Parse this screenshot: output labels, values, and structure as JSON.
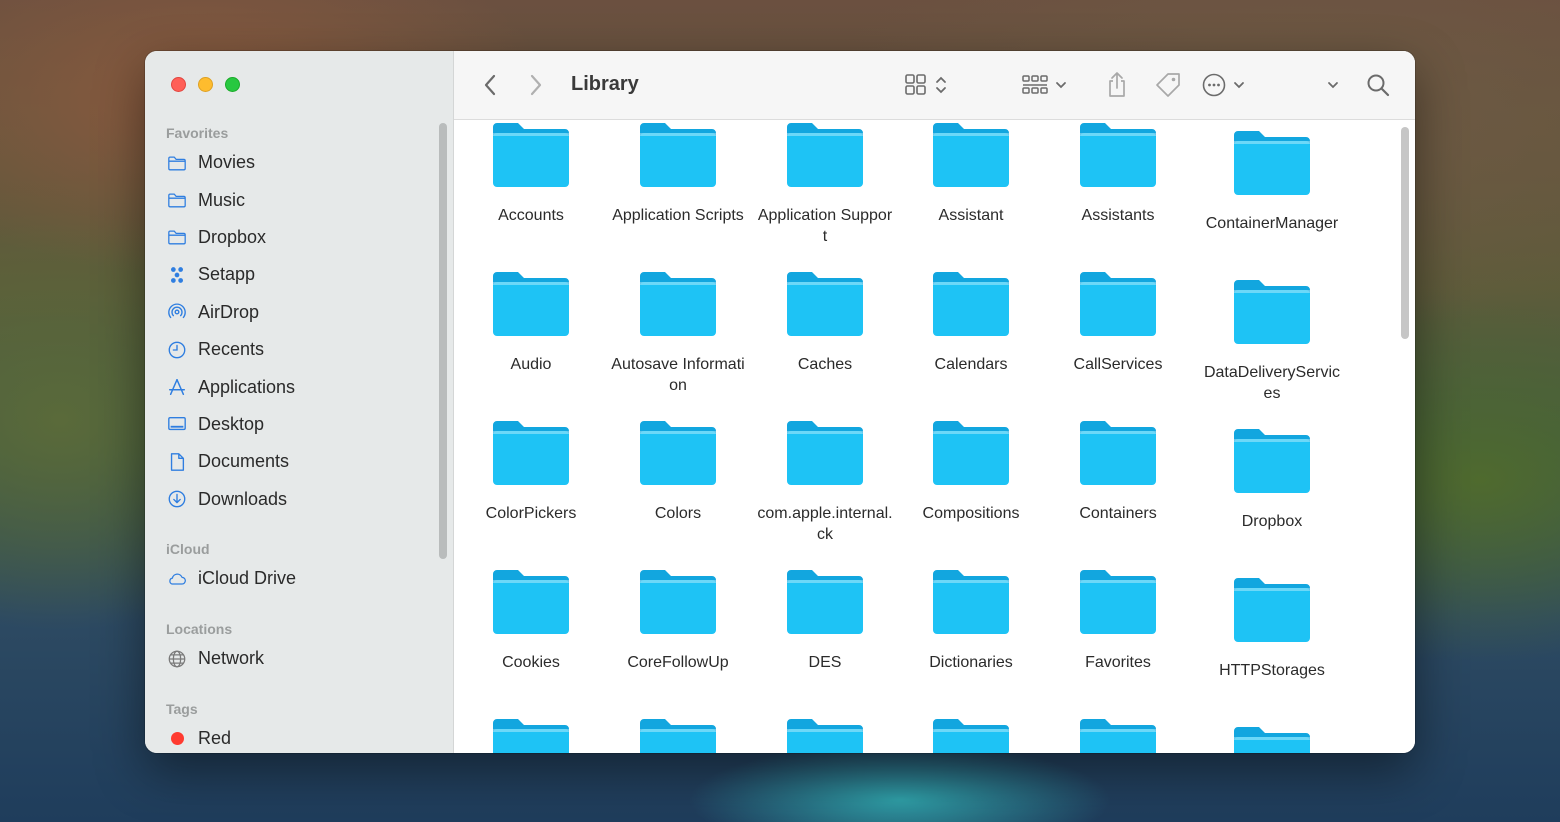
{
  "window": {
    "title": "Library"
  },
  "sidebar": {
    "favorites_heading": "Favorites",
    "favorites": [
      {
        "label": "Movies",
        "icon": "folder-icon"
      },
      {
        "label": "Music",
        "icon": "folder-icon"
      },
      {
        "label": "Dropbox",
        "icon": "folder-icon"
      },
      {
        "label": "Setapp",
        "icon": "setapp-icon"
      },
      {
        "label": "AirDrop",
        "icon": "airdrop-icon"
      },
      {
        "label": "Recents",
        "icon": "clock-icon"
      },
      {
        "label": "Applications",
        "icon": "applications-icon"
      },
      {
        "label": "Desktop",
        "icon": "desktop-icon"
      },
      {
        "label": "Documents",
        "icon": "document-icon"
      },
      {
        "label": "Downloads",
        "icon": "download-icon"
      }
    ],
    "icloud_heading": "iCloud",
    "icloud": [
      {
        "label": "iCloud Drive",
        "icon": "cloud-icon"
      }
    ],
    "locations_heading": "Locations",
    "locations": [
      {
        "label": "Network",
        "icon": "globe-icon"
      }
    ],
    "tags_heading": "Tags",
    "tags": [
      {
        "label": "Red",
        "color": "#ff3b30"
      }
    ]
  },
  "colors": {
    "accent": "#2f7ee0",
    "folder": "#1ec3f5",
    "folder_tab": "#12a6df"
  },
  "files": [
    [
      "Accounts",
      "Application Scripts",
      "Application Support",
      "Assistant",
      "Assistants",
      "ContainerManager"
    ],
    [
      "Audio",
      "Autosave Information",
      "Caches",
      "Calendars",
      "CallServices",
      "DataDeliveryServices"
    ],
    [
      "ColorPickers",
      "Colors",
      "com.apple.internal.ck",
      "Compositions",
      "Containers",
      "Dropbox"
    ],
    [
      "Cookies",
      "CoreFollowUp",
      "DES",
      "Dictionaries",
      "Favorites",
      "HTTPStorages"
    ]
  ]
}
